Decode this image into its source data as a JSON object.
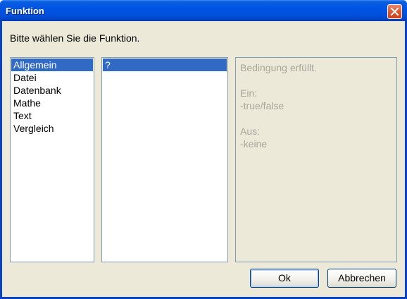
{
  "window": {
    "title": "Funktion"
  },
  "dialog": {
    "prompt": "Bitte wählen Sie die Funktion.",
    "categories": [
      {
        "label": "Allgemein",
        "selected": true
      },
      {
        "label": "Datei",
        "selected": false
      },
      {
        "label": "Datenbank",
        "selected": false
      },
      {
        "label": "Mathe",
        "selected": false
      },
      {
        "label": "Text",
        "selected": false
      },
      {
        "label": "Vergleich",
        "selected": false
      }
    ],
    "functions": [
      {
        "label": "?",
        "selected": true
      }
    ],
    "description": {
      "summary": "Bedingung erfüllt.",
      "input_heading": "Ein:",
      "input_value": "-true/false",
      "output_heading": "Aus:",
      "output_value": "-keine"
    },
    "ok_label": "Ok",
    "cancel_label": "Abbrechen"
  },
  "colors": {
    "titlebar": "#0054e3",
    "dialog_bg": "#ece9d8",
    "selection": "#316ac5",
    "disabled_text": "#a7a699",
    "close_button": "#e05a33"
  }
}
